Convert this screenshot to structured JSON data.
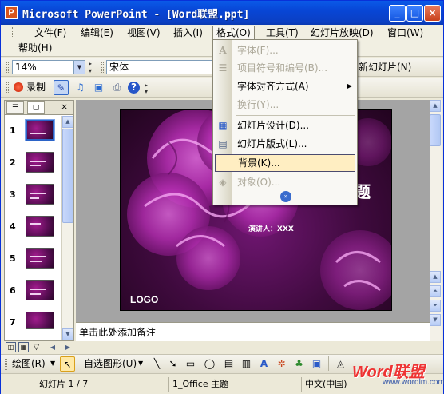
{
  "window": {
    "title": "Microsoft PowerPoint - [Word联盟.ppt]",
    "app_icon": "P",
    "controls": [
      "_",
      "□",
      "×"
    ]
  },
  "menubar": {
    "items": [
      {
        "label": "文件(F)"
      },
      {
        "label": "编辑(E)"
      },
      {
        "label": "视图(V)"
      },
      {
        "label": "插入(I)"
      },
      {
        "label": "格式(O)"
      },
      {
        "label": "工具(T)"
      },
      {
        "label": "幻灯片放映(D)"
      },
      {
        "label": "窗口(W)"
      },
      {
        "label": "帮助(H)"
      }
    ]
  },
  "toolbar": {
    "zoom_value": "14%",
    "font_name": "宋体",
    "new_slide_label": "新幻灯片(N)",
    "record_label": "录制"
  },
  "format_menu": {
    "items": [
      {
        "label": "字体(F)...",
        "disabled": true,
        "icon": "A"
      },
      {
        "label": "项目符号和编号(B)...",
        "disabled": true,
        "icon": "☰"
      },
      {
        "label": "字体对齐方式(A)",
        "disabled": false,
        "submenu": true
      },
      {
        "label": "换行(Y)...",
        "disabled": true
      },
      {
        "label": "幻灯片设计(D)...",
        "disabled": false,
        "icon": "▦"
      },
      {
        "label": "幻灯片版式(L)...",
        "disabled": false,
        "icon": "▤"
      },
      {
        "label": "背景(K)...",
        "disabled": false,
        "highlighted": true
      },
      {
        "label": "对象(O)...",
        "disabled": true,
        "icon": "◈"
      }
    ],
    "expand": "»"
  },
  "slides": {
    "numbers": [
      "1",
      "2",
      "3",
      "4",
      "5",
      "6",
      "7"
    ],
    "selected": "1"
  },
  "slide": {
    "title_partial": "题",
    "presenter": "演讲人：XXX",
    "logo": "LOGO"
  },
  "notes_placeholder": "单击此处添加备注",
  "drawing_toolbar": {
    "draw_label": "绘图(R)",
    "autoshapes_label": "自选图形(U)"
  },
  "status": {
    "slide_info": "幻灯片 1 / 7",
    "theme": "1_Office 主题",
    "language": "中文(中国)"
  },
  "watermark": {
    "brand": "Word联盟",
    "url": "www.wordlm.com"
  },
  "colors": {
    "title_bar": "#0846d6",
    "menu_highlight": "#ffeec2",
    "slide_bg": "#4a0c48",
    "pattern": "#c43bc0"
  }
}
